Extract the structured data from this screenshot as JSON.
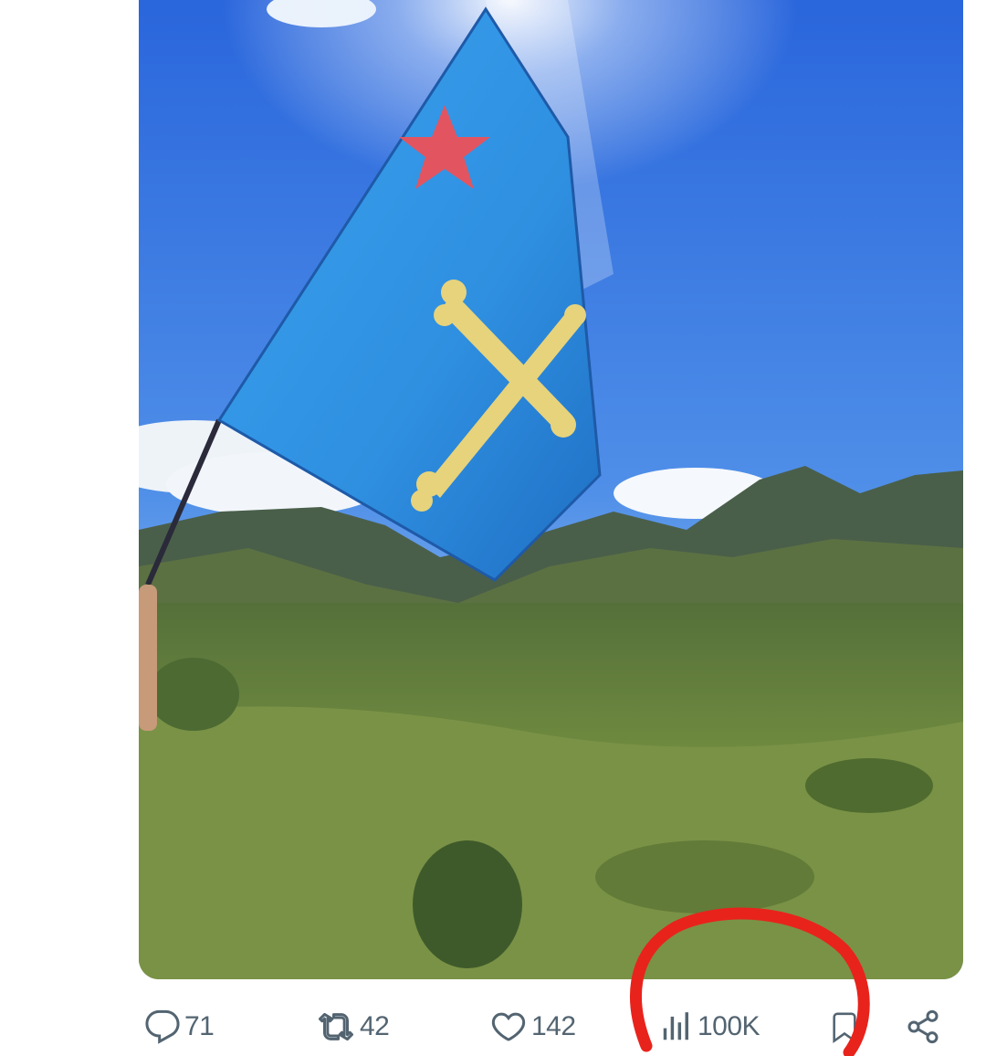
{
  "tweet": {
    "media": {
      "description_icon": "photo",
      "colors": {
        "sky_top": "#2f6fe0",
        "sky_bottom": "#7fb6ee",
        "flag_blue": "#3a9ae6",
        "cross_yellow": "#e8d27a",
        "star_red": "#e5505a",
        "grass": "#6e8a3a"
      }
    },
    "actions": {
      "reply_count": "71",
      "retweet_count": "42",
      "like_count": "142",
      "views_count": "100K"
    },
    "icons": {
      "reply": "reply-icon",
      "retweet": "retweet-icon",
      "like": "heart-icon",
      "views": "analytics-icon",
      "bookmark": "bookmark-icon",
      "share": "share-icon"
    }
  },
  "annotation": {
    "color": "#e8231c",
    "shape": "hand-drawn circle around views count"
  }
}
